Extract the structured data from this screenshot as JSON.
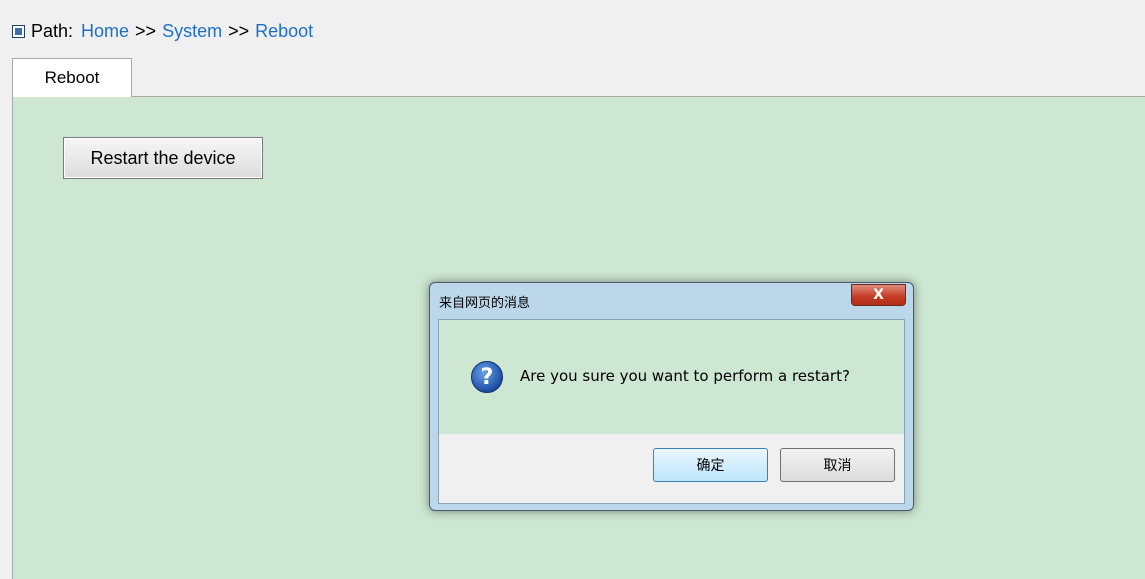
{
  "breadcrumb": {
    "label": "Path:",
    "items": [
      "Home",
      "System",
      "Reboot"
    ],
    "separator": ">>"
  },
  "tab": {
    "label": "Reboot"
  },
  "main": {
    "restart_button": "Restart the device"
  },
  "dialog": {
    "title": "来自网页的消息",
    "close_symbol": "X",
    "icon": "question-icon",
    "message": "Are you sure you want to perform a restart?",
    "ok_label": "确定",
    "cancel_label": "取消"
  },
  "colors": {
    "content_bg": "#cde7d2",
    "link": "#1f6fc5",
    "dialog_frame": "#bcd6ea",
    "close_button": "#c23a23"
  }
}
